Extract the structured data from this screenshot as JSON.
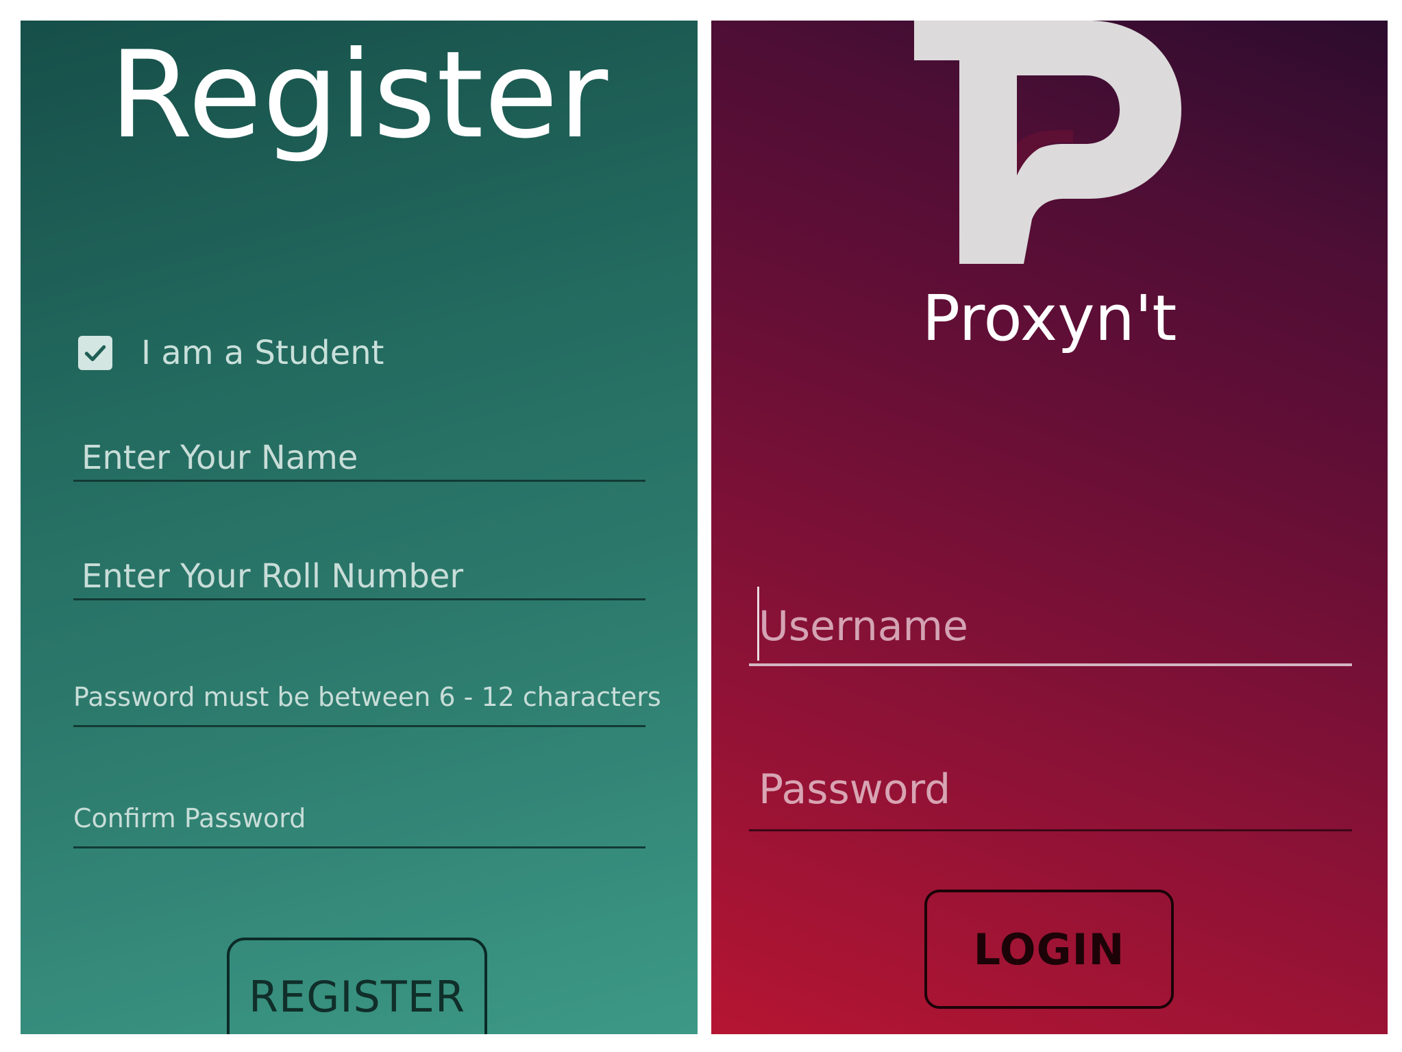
{
  "register_screen": {
    "title": "Register",
    "student_checkbox": {
      "label": "I am a Student",
      "checked": true
    },
    "fields": {
      "name_placeholder": "Enter Your Name",
      "roll_placeholder": "Enter Your Roll Number",
      "password_placeholder": "Password must be between 6 - 12 characters",
      "confirm_placeholder": "Confirm Password"
    },
    "register_button": "REGISTER",
    "gradient_colors": [
      "#164f49",
      "#3d9986"
    ]
  },
  "login_screen": {
    "logo_icon": "tp-logo-icon",
    "app_name": "Proxyn't",
    "fields": {
      "username_placeholder": "Username",
      "password_placeholder": "Password"
    },
    "login_button": "LOGIN",
    "gradient_colors": [
      "#2c0c2e",
      "#b51532"
    ]
  }
}
